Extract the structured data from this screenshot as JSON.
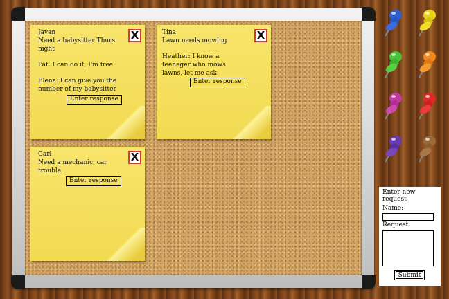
{
  "notes": [
    {
      "author": "Javan",
      "request": "Need a babysitter Thurs. night",
      "responses": [
        "Pat: I can do it, I'm free",
        "Elena: I can give you the number of my babysitter"
      ],
      "response_button": "Enter response",
      "close_label": "X"
    },
    {
      "author": "Tina",
      "request": "Lawn needs mowing",
      "responses": [
        "Heather: I know a teenager who mows lawns, let me ask"
      ],
      "response_button": "Enter response",
      "close_label": "X"
    },
    {
      "author": "Carl",
      "request": "Need a mechanic, car trouble",
      "responses": [],
      "response_button": "Enter response",
      "close_label": "X"
    }
  ],
  "pins": [
    {
      "name": "blue-pin",
      "color": "#2f5fd0"
    },
    {
      "name": "yellow-pin",
      "color": "#e8d21c"
    },
    {
      "name": "green-pin",
      "color": "#4cc23a"
    },
    {
      "name": "orange-pin",
      "color": "#ef8a1f"
    },
    {
      "name": "magenta-pin",
      "color": "#c03aa0"
    },
    {
      "name": "red-pin",
      "color": "#e02a2a"
    },
    {
      "name": "purple-pin",
      "color": "#6a3ab0"
    },
    {
      "name": "brown-pin",
      "color": "#9a6a3a"
    }
  ],
  "form": {
    "title": "Enter new request",
    "name_label": "Name:",
    "name_value": "",
    "request_label": "Request:",
    "request_value": "",
    "submit_label": "Submit"
  }
}
